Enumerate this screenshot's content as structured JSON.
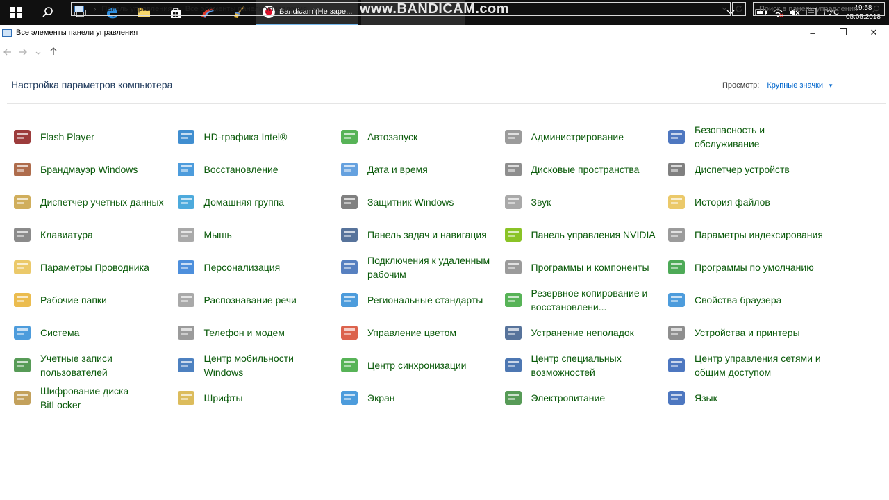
{
  "taskbar": {
    "active_task": "Bandicam (Не заре...",
    "watermark": "www.BANDICAM.com",
    "language": "РУС",
    "time": "19:58",
    "date": "05.05.2018"
  },
  "window": {
    "title": "Все элементы панели управления",
    "controls": [
      "–",
      "❐",
      "✕"
    ]
  },
  "address": {
    "crumbs": [
      "Панель управления",
      "Все элементы панели управления"
    ],
    "search_placeholder": "Поиск в панели управления"
  },
  "header": {
    "title": "Настройка параметров компьютера",
    "view_label": "Просмотр:",
    "view_value": "Крупные значки"
  },
  "colors": {
    "item_text": "#0a5a0a",
    "title": "#1e395b",
    "link": "#0066cc",
    "taskbar": "#101010"
  },
  "items": [
    {
      "label": "Flash Player",
      "icon": "flash-icon",
      "color": "#8b1a1a"
    },
    {
      "label": "HD-графика Intel®",
      "icon": "intel-graphics-icon",
      "color": "#1f7ac8"
    },
    {
      "label": "Автозапуск",
      "icon": "autoplay-icon",
      "color": "#3aa63a"
    },
    {
      "label": "Администрирование",
      "icon": "admin-tools-icon",
      "color": "#8a8a8a"
    },
    {
      "label": "Безопасность и обслуживание",
      "icon": "flag-icon",
      "color": "#2f5fb5"
    },
    {
      "label": "Брандмауэр Windows",
      "icon": "firewall-icon",
      "color": "#a0522d"
    },
    {
      "label": "Восстановление",
      "icon": "recovery-icon",
      "color": "#2e8bd6"
    },
    {
      "label": "Дата и время",
      "icon": "calendar-clock-icon",
      "color": "#4a90d9"
    },
    {
      "label": "Дисковые пространства",
      "icon": "storage-spaces-icon",
      "color": "#7a7a7a"
    },
    {
      "label": "Диспетчер устройств",
      "icon": "device-manager-icon",
      "color": "#6a6a6a"
    },
    {
      "label": "Диспетчер учетных данных",
      "icon": "credential-icon",
      "color": "#c8a040"
    },
    {
      "label": "Домашняя группа",
      "icon": "homegroup-icon",
      "color": "#2e9bd6"
    },
    {
      "label": "Защитник Windows",
      "icon": "defender-icon",
      "color": "#6a6a6a"
    },
    {
      "label": "Звук",
      "icon": "speaker-icon",
      "color": "#9a9a9a"
    },
    {
      "label": "История файлов",
      "icon": "file-history-icon",
      "color": "#e8c050"
    },
    {
      "label": "Клавиатура",
      "icon": "keyboard-icon",
      "color": "#777777"
    },
    {
      "label": "Мышь",
      "icon": "mouse-icon",
      "color": "#9a9a9a"
    },
    {
      "label": "Панель задач и навигация",
      "icon": "taskbar-icon",
      "color": "#3a5a8a"
    },
    {
      "label": "Панель управления NVIDIA",
      "icon": "nvidia-icon",
      "color": "#76b900"
    },
    {
      "label": "Параметры индексирования",
      "icon": "indexing-icon",
      "color": "#8a8a8a"
    },
    {
      "label": "Параметры Проводника",
      "icon": "folder-options-icon",
      "color": "#e8c050"
    },
    {
      "label": "Персонализация",
      "icon": "personalization-icon",
      "color": "#2e7bd6"
    },
    {
      "label": "Подключения к удаленным рабочим",
      "icon": "remote-desktop-icon",
      "color": "#3a6ab5"
    },
    {
      "label": "Программы и компоненты",
      "icon": "programs-icon",
      "color": "#8a8a8a"
    },
    {
      "label": "Программы по умолчанию",
      "icon": "default-programs-icon",
      "color": "#2e9b3a"
    },
    {
      "label": "Рабочие папки",
      "icon": "work-folders-icon",
      "color": "#e8b030"
    },
    {
      "label": "Распознавание речи",
      "icon": "microphone-icon",
      "color": "#9a9a9a"
    },
    {
      "label": "Региональные стандарты",
      "icon": "region-icon",
      "color": "#2e8bd6"
    },
    {
      "label": "Резервное копирование и восстановлени...",
      "icon": "backup-icon",
      "color": "#3aa63a"
    },
    {
      "label": "Свойства браузера",
      "icon": "internet-options-icon",
      "color": "#2e8bd6"
    },
    {
      "label": "Система",
      "icon": "system-icon",
      "color": "#2e8bd6"
    },
    {
      "label": "Телефон и модем",
      "icon": "phone-modem-icon",
      "color": "#8a8a8a"
    },
    {
      "label": "Управление цветом",
      "icon": "color-management-icon",
      "color": "#d6482e"
    },
    {
      "label": "Устранение неполадок",
      "icon": "troubleshooting-icon",
      "color": "#3a5a8a"
    },
    {
      "label": "Устройства и принтеры",
      "icon": "printer-icon",
      "color": "#7a7a7a"
    },
    {
      "label": "Учетные записи пользователей",
      "icon": "user-accounts-icon",
      "color": "#3a8a3a"
    },
    {
      "label": "Центр мобильности Windows",
      "icon": "mobility-center-icon",
      "color": "#2e6bb5"
    },
    {
      "label": "Центр синхронизации",
      "icon": "sync-center-icon",
      "color": "#3aa63a"
    },
    {
      "label": "Центр специальных возможностей",
      "icon": "accessibility-icon",
      "color": "#2e5fa5"
    },
    {
      "label": "Центр управления сетями и общим доступом",
      "icon": "network-icon",
      "color": "#2e5fb5"
    },
    {
      "label": "Шифрование диска BitLocker",
      "icon": "bitlocker-icon",
      "color": "#b89040"
    },
    {
      "label": "Шрифты",
      "icon": "fonts-icon",
      "color": "#d6b040"
    },
    {
      "label": "Экран",
      "icon": "display-icon",
      "color": "#2e8bd6"
    },
    {
      "label": "Электропитание",
      "icon": "power-options-icon",
      "color": "#3a8a3a"
    },
    {
      "label": "Язык",
      "icon": "language-icon",
      "color": "#2e5fb5"
    }
  ]
}
